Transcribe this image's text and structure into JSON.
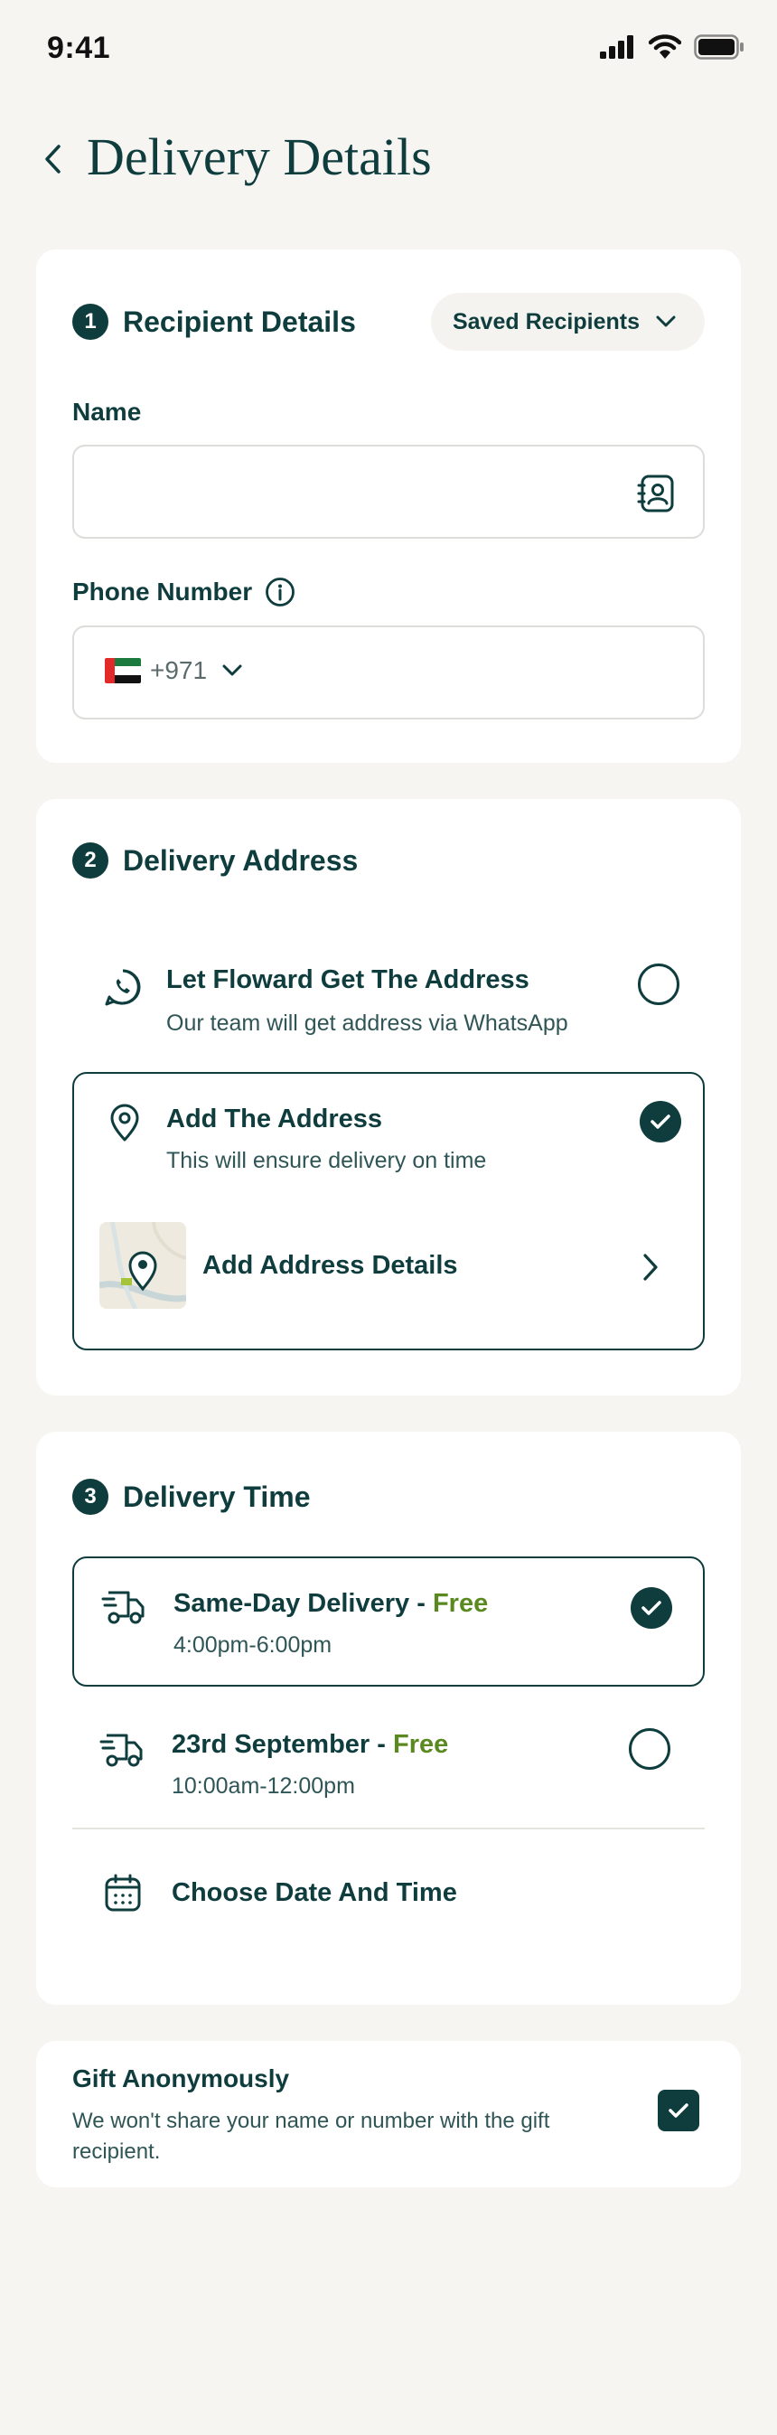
{
  "status_bar": {
    "time": "9:41"
  },
  "header": {
    "title": "Delivery Details"
  },
  "recipient": {
    "step": "1",
    "title": "Recipient Details",
    "saved_label": "Saved Recipients",
    "name_label": "Name",
    "name_value": "",
    "phone_label": "Phone Number",
    "phone_code": "+971",
    "phone_value": ""
  },
  "address": {
    "step": "2",
    "title": "Delivery Address",
    "options": [
      {
        "title": "Let Floward Get The Address",
        "subtitle": "Our team will get address via WhatsApp",
        "selected": false
      },
      {
        "title": "Add The Address",
        "subtitle": "This will ensure delivery on time",
        "selected": true
      }
    ],
    "details_label": "Add Address Details"
  },
  "delivery_time": {
    "step": "3",
    "title": "Delivery Time",
    "options": [
      {
        "title": "Same-Day Delivery - ",
        "price": "Free",
        "time": "4:00pm-6:00pm",
        "selected": true
      },
      {
        "title": "23rd September - ",
        "price": "Free",
        "time": "10:00am-12:00pm",
        "selected": false
      }
    ],
    "choose_label": "Choose Date And Time"
  },
  "gift": {
    "title": "Gift Anonymously",
    "subtitle": "We won't share your name or number with the gift recipient.",
    "checked": true
  },
  "colors": {
    "primary": "#0f3d3e",
    "accent_free": "#5a8a1f",
    "background": "#f6f5f1"
  }
}
